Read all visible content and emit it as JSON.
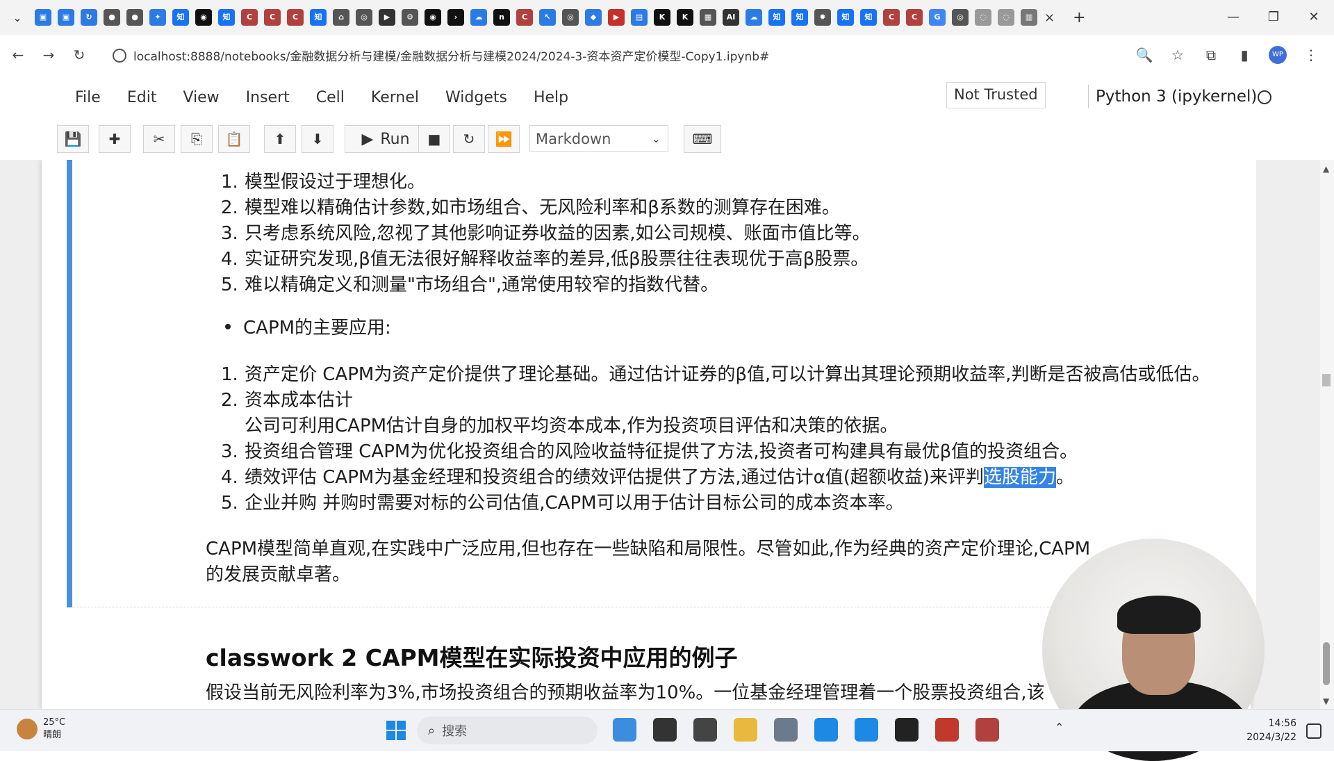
{
  "browser": {
    "tab_menu": "⌄",
    "tab_favicons": [
      {
        "name": "calendar-tab-icon",
        "color": "#2c7be5",
        "glyph": "▣"
      },
      {
        "name": "calendar-tab-icon",
        "color": "#2c7be5",
        "glyph": "▣"
      },
      {
        "name": "refresh-tab-icon",
        "color": "#2c7be5",
        "glyph": "↻"
      },
      {
        "name": "record-tab-icon",
        "color": "#555555",
        "glyph": "●"
      },
      {
        "name": "record-tab-icon",
        "color": "#555555",
        "glyph": "●"
      },
      {
        "name": "puzzle-tab-icon",
        "color": "#2c7be5",
        "glyph": "✦"
      },
      {
        "name": "zhihu-tab-icon",
        "color": "#1772f6",
        "glyph": "知"
      },
      {
        "name": "github-tab-icon",
        "color": "#111111",
        "glyph": "◉"
      },
      {
        "name": "zhihu-tab-icon",
        "color": "#1772f6",
        "glyph": "知"
      },
      {
        "name": "c-tab-icon",
        "color": "#b0413e",
        "glyph": "C"
      },
      {
        "name": "c-tab-icon",
        "color": "#b0413e",
        "glyph": "C"
      },
      {
        "name": "c-tab-icon",
        "color": "#b0413e",
        "glyph": "C"
      },
      {
        "name": "zhihu-tab-icon",
        "color": "#1772f6",
        "glyph": "知"
      },
      {
        "name": "home-tab-icon",
        "color": "#555555",
        "glyph": "⌂"
      },
      {
        "name": "globe-tab-icon",
        "color": "#555555",
        "glyph": "◎"
      },
      {
        "name": "video-tab-icon",
        "color": "#333333",
        "glyph": "▶"
      },
      {
        "name": "gear-tab-icon",
        "color": "#555555",
        "glyph": "⚙"
      },
      {
        "name": "github-tab-icon",
        "color": "#111111",
        "glyph": "◉"
      },
      {
        "name": "terminal-tab-icon",
        "color": "#111111",
        "glyph": "›"
      },
      {
        "name": "cloud-tab-icon",
        "color": "#2c7be5",
        "glyph": "☁"
      },
      {
        "name": "n-tab-icon",
        "color": "#111111",
        "glyph": "n"
      },
      {
        "name": "c-tab-icon",
        "color": "#b0413e",
        "glyph": "C"
      },
      {
        "name": "cursor-tab-icon",
        "color": "#2c7be5",
        "glyph": "↖"
      },
      {
        "name": "globe-tab-icon",
        "color": "#555555",
        "glyph": "◎"
      },
      {
        "name": "vscode-tab-icon",
        "color": "#2c7be5",
        "glyph": "◆"
      },
      {
        "name": "youtube-tab-icon",
        "color": "#c4302b",
        "glyph": "▶"
      },
      {
        "name": "chart-tab-icon",
        "color": "#2c7be5",
        "glyph": "▤"
      },
      {
        "name": "k-tab-icon",
        "color": "#111111",
        "glyph": "K"
      },
      {
        "name": "k-tab-icon",
        "color": "#111111",
        "glyph": "K"
      },
      {
        "name": "grid-tab-icon",
        "color": "#555555",
        "glyph": "▦"
      },
      {
        "name": "ai-tab-icon",
        "color": "#333333",
        "glyph": "AI"
      },
      {
        "name": "cloud-tab-icon",
        "color": "#2c7be5",
        "glyph": "☁"
      },
      {
        "name": "zhihu-tab-icon",
        "color": "#1772f6",
        "glyph": "知"
      },
      {
        "name": "zhihu-tab-icon",
        "color": "#1772f6",
        "glyph": "知"
      },
      {
        "name": "bug-tab-icon",
        "color": "#555555",
        "glyph": "✹"
      },
      {
        "name": "zhihu-tab-icon",
        "color": "#1772f6",
        "glyph": "知"
      },
      {
        "name": "zhihu-tab-icon",
        "color": "#1772f6",
        "glyph": "知"
      },
      {
        "name": "c-tab-icon",
        "color": "#b0413e",
        "glyph": "C"
      },
      {
        "name": "c-tab-icon",
        "color": "#b0413e",
        "glyph": "C"
      },
      {
        "name": "google-tab-icon",
        "color": "#4285f4",
        "glyph": "G"
      },
      {
        "name": "globe-tab-icon",
        "color": "#555555",
        "glyph": "◎"
      },
      {
        "name": "loading-tab-icon",
        "color": "#999999",
        "glyph": "◌"
      },
      {
        "name": "loading-tab-icon",
        "color": "#999999",
        "glyph": "◌"
      },
      {
        "name": "notebook-tab-icon",
        "color": "#777777",
        "glyph": "▥"
      }
    ],
    "close_tab": "×",
    "new_tab": "+",
    "window_controls": {
      "minimize": "—",
      "restore": "❐",
      "close": "✕"
    },
    "nav": {
      "back": "←",
      "forward": "→",
      "reload": "↻"
    },
    "url": "localhost:8888/notebooks/金融数据分析与建模/金融数据分析与建模2024/2024-3-资本资产定价模型-Copy1.ipynb#",
    "right_icons": {
      "zoom": "🔍",
      "star": "☆",
      "extensions": "⧉",
      "sidebar": "▮",
      "profile": "WP",
      "menu": "⋮"
    }
  },
  "jupyter": {
    "menu": [
      "File",
      "Edit",
      "View",
      "Insert",
      "Cell",
      "Kernel",
      "Widgets",
      "Help"
    ],
    "trust": "Not Trusted",
    "kernel": "Python 3 (ipykernel)",
    "toolbar": {
      "save": "💾",
      "add": "✚",
      "cut": "✂",
      "copy": "⎘",
      "paste": "📋",
      "up": "⬆",
      "down": "⬇",
      "run_icon": "▶",
      "run_label": "Run",
      "stop": "■",
      "restart": "↻",
      "fastforward": "⏩",
      "keyboard": "⌨"
    },
    "cell_type": "Markdown"
  },
  "cell": {
    "limitations": [
      {
        "n": "1.",
        "text": "模型假设过于理想化。"
      },
      {
        "n": "2.",
        "text": "模型难以精确估计参数,如市场组合、无风险利率和β系数的测算存在困难。"
      },
      {
        "n": "3.",
        "text": "只考虑系统风险,忽视了其他影响证券收益的因素,如公司规模、账面市值比等。"
      },
      {
        "n": "4.",
        "text": "实证研究发现,β值无法很好解释收益率的差异,低β股票往往表现优于高β股票。"
      },
      {
        "n": "5.",
        "text": "难以精确定义和测量\"市场组合\",通常使用较窄的指数代替。"
      }
    ],
    "bullet": "CAPM的主要应用:",
    "applications": [
      {
        "n": "1.",
        "text": "资产定价 CAPM为资产定价提供了理论基础。通过估计证券的β值,可以计算出其理论预期收益率,判断是否被高估或低估。"
      },
      {
        "n": "2.",
        "text": "资本成本估计"
      },
      {
        "n": "",
        "text": "公司可利用CAPM估计自身的加权平均资本成本,作为投资项目评估和决策的依据。"
      },
      {
        "n": "3.",
        "text": "投资组合管理 CAPM为优化投资组合的风险收益特征提供了方法,投资者可构建具有最优β值的投资组合。"
      },
      {
        "n": "4.",
        "text": "绩效评估 CAPM为基金经理和投资组合的绩效评估提供了方法,通过估计α值(超额收益)来评判"
      },
      {
        "n": "5.",
        "text": "企业并购 并购时需要对标的公司估值,CAPM可以用于估计目标公司的成本资本率。"
      }
    ],
    "highlight": "选股能力",
    "after_highlight": "。",
    "summary_line1": "CAPM模型简单直观,在实践中广泛应用,但也存在一些缺陷和局限性。尽管如此,作为经典的资产定价理论,CAPM",
    "summary_line2": "的发展贡献卓著。"
  },
  "cell2": {
    "heading": "classwork 2 CAPM模型在实际投资中应用的例子",
    "text": "假设当前无风险利率为3%,市场投资组合的预期收益率为10%。一位基金经理管理着一个股票投资组合,该"
  },
  "taskbar": {
    "temp": "25°C",
    "weather": "晴朗",
    "search_placeholder": "搜索",
    "apps": [
      {
        "name": "widgets-app-icon",
        "color": "#3c8dde"
      },
      {
        "name": "file-explorer-app-icon",
        "color": "#333333"
      },
      {
        "name": "monitor-app-icon",
        "color": "#444444"
      },
      {
        "name": "folder-app-icon",
        "color": "#e8b83f"
      },
      {
        "name": "chrome-app-icon",
        "color": "#6b7b8c"
      },
      {
        "name": "check-app-icon",
        "color": "#1e88e5"
      },
      {
        "name": "bookmark-app-icon",
        "color": "#1e88e5"
      },
      {
        "name": "terminal-app-icon",
        "color": "#222222"
      },
      {
        "name": "wps-app-icon",
        "color": "#c0392b"
      },
      {
        "name": "record-app-icon",
        "color": "#b0413e"
      }
    ],
    "tray_chevron": "⌃",
    "time": "14:56",
    "date": "2024/3/22"
  }
}
